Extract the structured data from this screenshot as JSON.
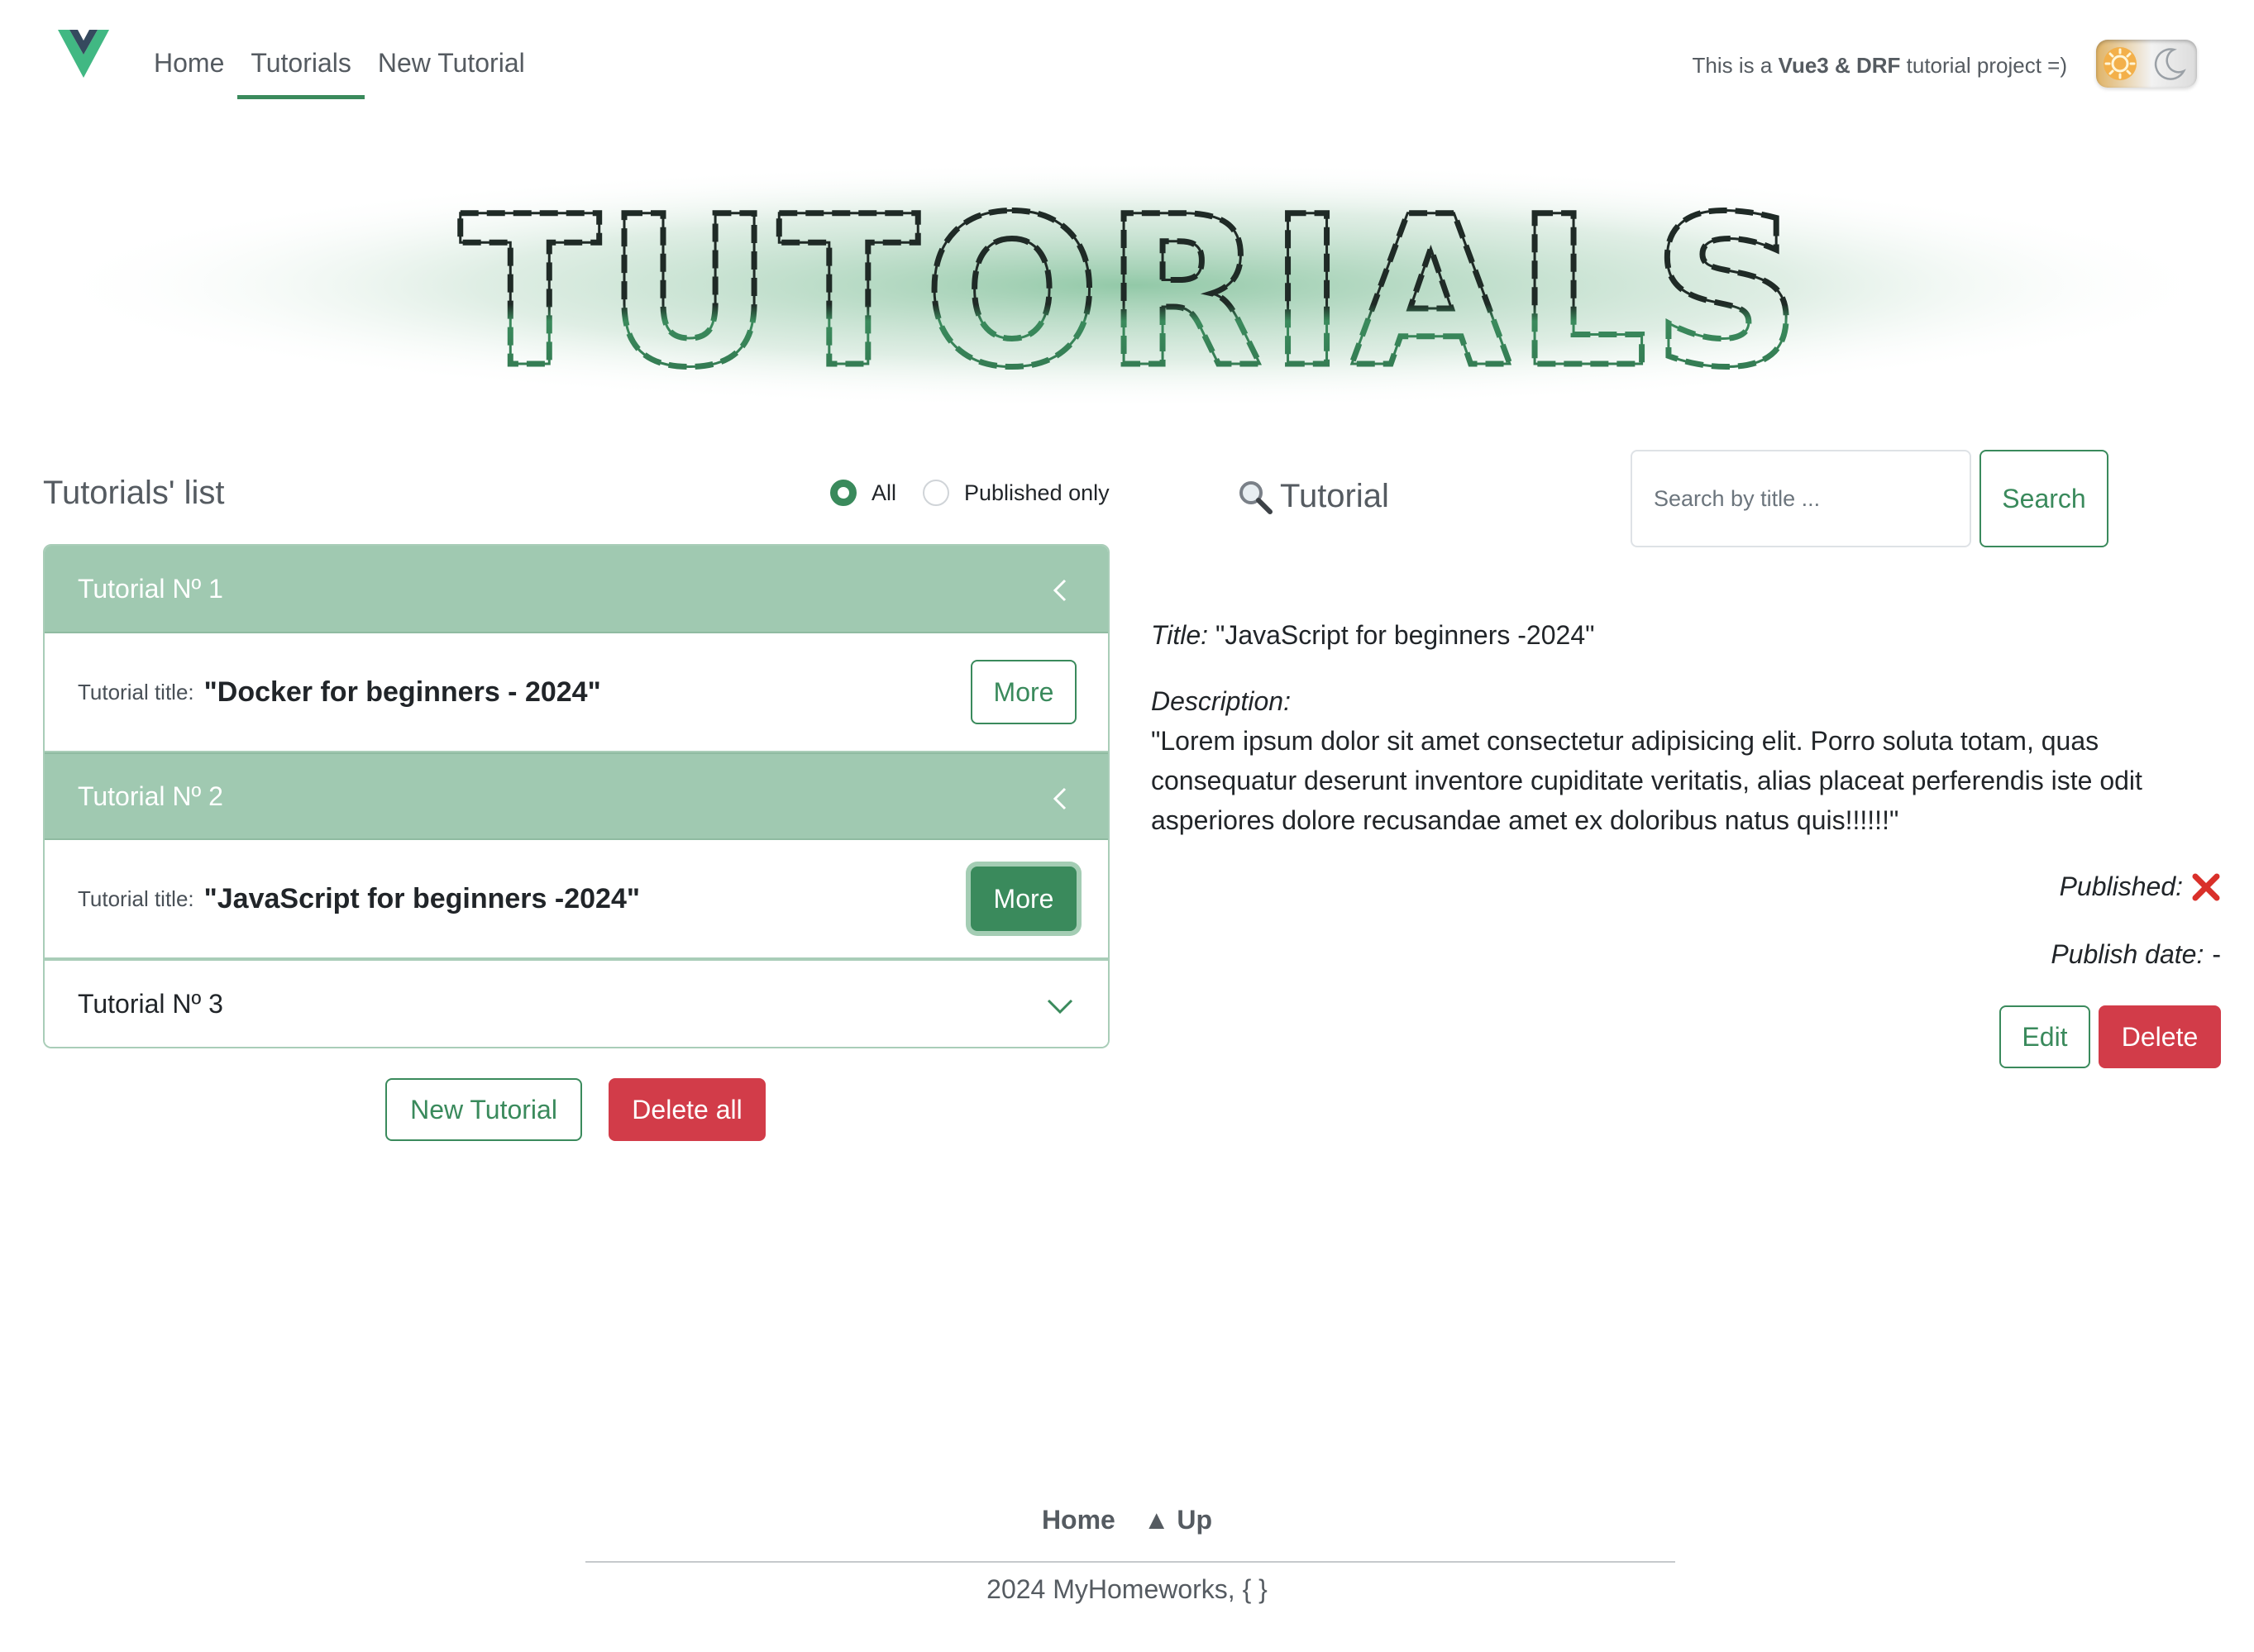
{
  "nav": {
    "items": [
      {
        "label": "Home"
      },
      {
        "label": "Tutorials"
      },
      {
        "label": "New Tutorial"
      }
    ],
    "active": "Tutorials"
  },
  "header": {
    "tagline_prefix": "This is a ",
    "tagline_bold": "Vue3 & DRF",
    "tagline_suffix": " tutorial project =)"
  },
  "banner": {
    "text": "TUTORIALS"
  },
  "list": {
    "title": "Tutorials' list",
    "filters": [
      {
        "label": "All",
        "checked": true
      },
      {
        "label": "Published only",
        "checked": false
      }
    ],
    "items": [
      {
        "header": "Tutorial Nº 1",
        "title_label": "Tutorial title:",
        "title": "\"Docker for beginners - 2024\"",
        "more": "More",
        "expanded": true,
        "selected": false
      },
      {
        "header": "Tutorial Nº 2",
        "title_label": "Tutorial title:",
        "title": "\"JavaScript for beginners -2024\"",
        "more": "More",
        "expanded": true,
        "selected": true
      },
      {
        "header": "Tutorial Nº 3",
        "expanded": false
      }
    ],
    "new_button": "New Tutorial",
    "delete_all_button": "Delete all"
  },
  "detail": {
    "heading": "Tutorial",
    "search_placeholder": "Search by title ...",
    "search_button": "Search",
    "title_label": "Title:",
    "title_value": "\"JavaScript for beginners -2024\"",
    "description_label": "Description:",
    "description_value": "\"Lorem ipsum dolor sit amet consectetur adipisicing elit. Porro soluta totam, quas consequatur deserunt inventore cupiditate veritatis, alias placeat perferendis iste odit asperiores dolore recusandae amet ex doloribus natus quis!!!!!!\"",
    "published_label": "Published:",
    "published": false,
    "publish_date_label": "Publish date:",
    "publish_date_value": "-",
    "edit_button": "Edit",
    "delete_button": "Delete"
  },
  "footer": {
    "home": "Home",
    "up": "▲ Up",
    "copyright": "2024 MyHomeworks, { }"
  },
  "colors": {
    "accent": "#3a8a5c",
    "accordion_header": "#a0c9b1",
    "danger": "#d23c49",
    "text_muted": "#555b61"
  }
}
